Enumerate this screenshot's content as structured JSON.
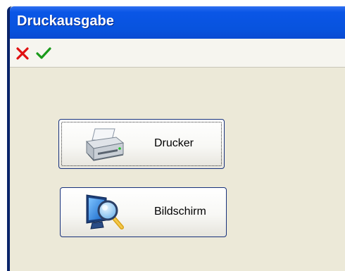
{
  "window": {
    "title": "Druckausgabe"
  },
  "toolbar": {
    "cancel_icon": "close-x-red",
    "confirm_icon": "checkmark-green"
  },
  "buttons": {
    "printer": {
      "label": "Drucker",
      "icon": "printer-icon"
    },
    "screen": {
      "label": "Bildschirm",
      "icon": "monitor-magnifier-icon"
    }
  },
  "colors": {
    "titlebar": "#0853de",
    "cancel": "#e01010",
    "confirm": "#1a9a1a",
    "button_border": "#17317b",
    "face": "#ece9d8"
  }
}
